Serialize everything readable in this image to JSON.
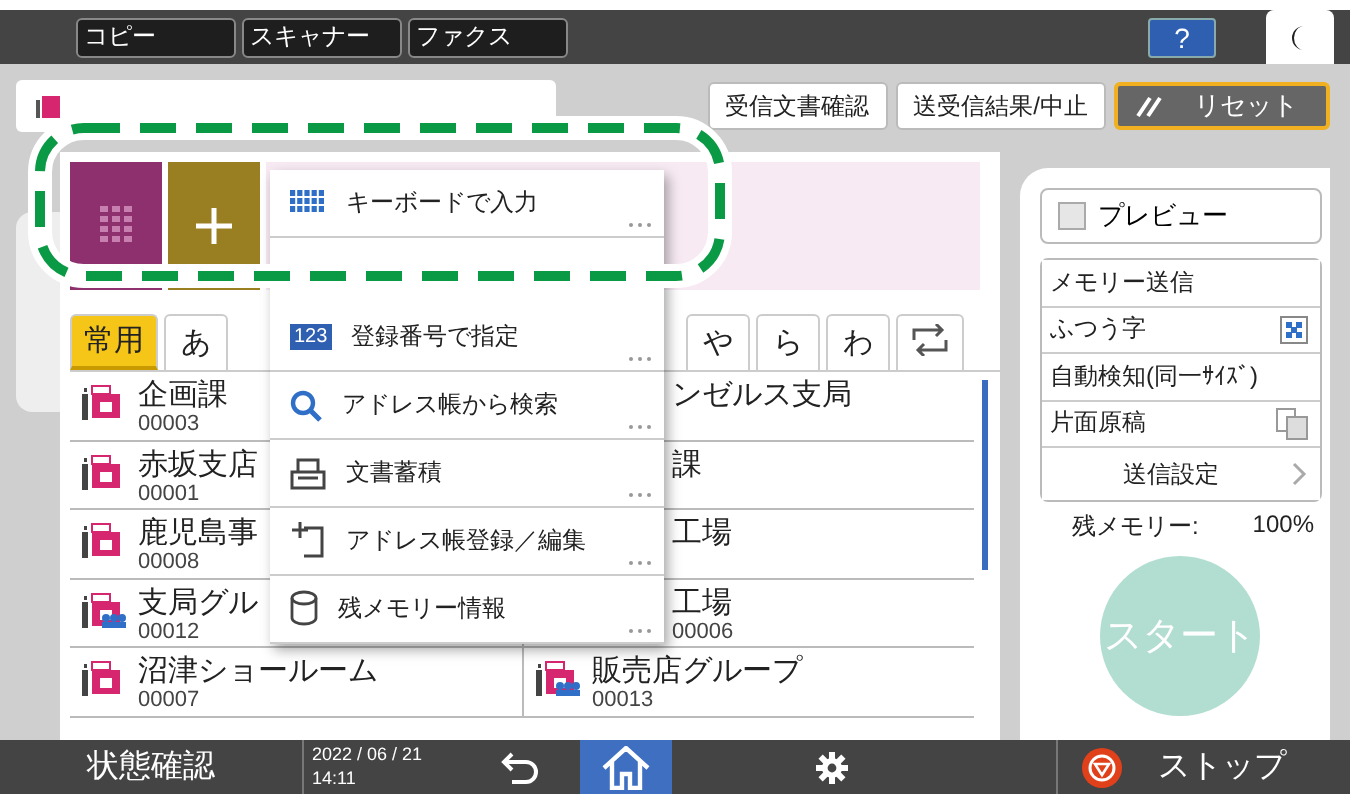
{
  "mode_tabs": [
    {
      "label": "コピー",
      "selected": false
    },
    {
      "label": "スキャナー",
      "selected": false
    },
    {
      "label": "ファクス",
      "selected": false
    }
  ],
  "help_button": {
    "label": "?"
  },
  "header_buttons": [
    {
      "label": "受信文書確認",
      "kind": "plain"
    },
    {
      "label": "送受信結果/中止",
      "kind": "plain"
    },
    {
      "label": "リセット",
      "kind": "reset"
    }
  ],
  "index_tabs": [
    {
      "label": "常用",
      "selected": true,
      "kind": "text"
    },
    {
      "label": "あ",
      "selected": false,
      "kind": "text"
    },
    {
      "label": "や",
      "selected": false,
      "kind": "text"
    },
    {
      "label": "ら",
      "selected": false,
      "kind": "text"
    },
    {
      "label": "わ",
      "selected": false,
      "kind": "text"
    },
    {
      "kind": "switch",
      "selected": false
    }
  ],
  "destinations": [
    {
      "name": "企画課",
      "number": "00003",
      "kind": "fax"
    },
    {
      "name": "ンゼルス支局",
      "kind": "partial"
    },
    {
      "name": "赤坂支店",
      "number": "00001",
      "kind": "fax"
    },
    {
      "name": "課",
      "kind": "partial"
    },
    {
      "name": "鹿児島事",
      "number": "00008",
      "kind": "fax"
    },
    {
      "name": "工場",
      "kind": "partial"
    },
    {
      "name": "支局グル",
      "number": "00012",
      "kind": "group"
    },
    {
      "name": "工場",
      "number": "00006",
      "kind": "partial"
    },
    {
      "name": "沼津ショールーム",
      "number": "00007",
      "kind": "fax"
    },
    {
      "name": "販売店グループ",
      "number": "00013",
      "kind": "group"
    }
  ],
  "menu": [
    {
      "kind": "keyboard",
      "label": "キーボードで入力"
    },
    {
      "kind": "number",
      "badge": "123",
      "label": "登録番号で指定"
    },
    {
      "kind": "search",
      "label": "アドレス帳から検索"
    },
    {
      "kind": "storage",
      "label": "文書蓄積"
    },
    {
      "kind": "register",
      "label": "アドレス帳登録／編集"
    },
    {
      "kind": "memory",
      "label": "残メモリー情報"
    }
  ],
  "preview": {
    "label": "プレビュー",
    "checked": false
  },
  "settings": [
    {
      "label": "メモリー送信",
      "kind": "text"
    },
    {
      "label": "ふつう字",
      "kind": "resolution"
    },
    {
      "label": "自動検知(同一ｻｲｽﾞ)",
      "kind": "text"
    },
    {
      "label": "片面原稿",
      "kind": "sides"
    },
    {
      "label": "送信設定",
      "kind": "more"
    }
  ],
  "memory": {
    "label": "残メモリー:",
    "value": "100%"
  },
  "start_button": {
    "label": "スタート",
    "disabled": true
  },
  "status_bar": {
    "status": "状態確認",
    "date": "2022 / 06 / 21",
    "time": "14:11",
    "nav": [
      {
        "kind": "back",
        "selected": false
      },
      {
        "kind": "home",
        "selected": true
      },
      {
        "kind": "settings",
        "selected": false
      }
    ],
    "stop": "ストップ"
  }
}
